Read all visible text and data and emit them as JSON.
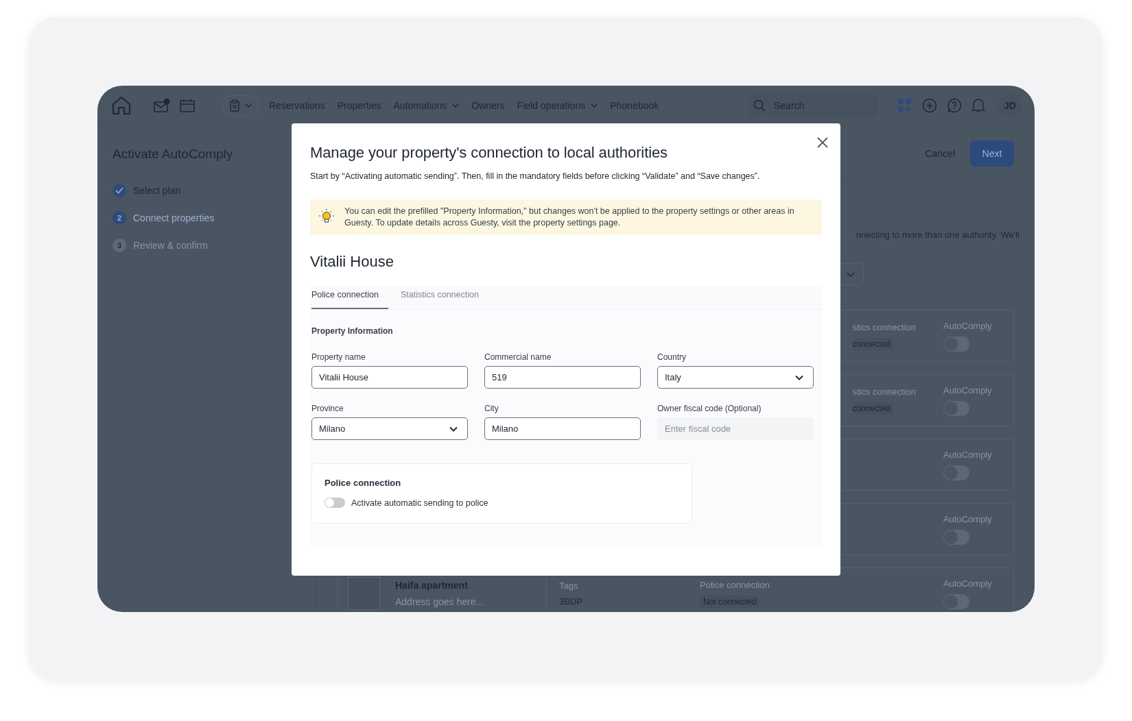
{
  "nav": {
    "items": [
      {
        "label": "Reservations",
        "dropdown": false
      },
      {
        "label": "Properties",
        "dropdown": false
      },
      {
        "label": "Automations",
        "dropdown": true
      },
      {
        "label": "Owners",
        "dropdown": false
      },
      {
        "label": "Field operations",
        "dropdown": true
      },
      {
        "label": "Phonebook",
        "dropdown": false
      }
    ],
    "search": {
      "placeholder": "Search"
    },
    "avatar": "JD"
  },
  "sidebar": {
    "title": "Activate AutoComply",
    "steps": [
      {
        "label": "Select plan",
        "completed": true,
        "selected": false
      },
      {
        "label": "Connect properties",
        "completed": false,
        "selected": true,
        "number": "2"
      },
      {
        "label": "Review & confirm",
        "completed": false,
        "selected": false,
        "number": "3"
      }
    ]
  },
  "header": {
    "cancel": "Cancel",
    "next": "Next"
  },
  "intro_text": "nnecting to more than one authority. We'll",
  "property_rows": [
    {
      "kind": "partial",
      "statistics_label": "stics connection",
      "status": "connected",
      "autocomply_label": "AutoComply",
      "on": false
    },
    {
      "kind": "partial",
      "statistics_label": "stics connection",
      "status": "connected",
      "autocomply_label": "AutoComply",
      "on": false
    },
    {
      "kind": "toggle",
      "autocomply_label": "AutoComply",
      "on": false
    },
    {
      "kind": "toggle",
      "autocomply_label": "AutoComply",
      "on": false
    },
    {
      "kind": "full",
      "name": "Haifa apartment",
      "address": "Address goes here...",
      "tags_label": "Tags",
      "tag": "3BDP",
      "police_label": "Police connection",
      "status": "Not connected",
      "autocomply_label": "AutoComply",
      "on": false
    }
  ],
  "modal": {
    "title": "Manage your property's connection to local authorities",
    "subtitle": "Start by “Activating automatic sending”. Then, fill in the mandatory fields before clicking “Validate” and “Save changes”.",
    "notice": "You can edit the prefilled \"Property Information,\" but changes won't be applied to the property settings or other areas in Guesty. To update details across Guesty, visit the property settings page.",
    "property_title": "Vitalii House",
    "tabs": [
      {
        "label": "Police connection",
        "selected": true
      },
      {
        "label": "Statistics connection",
        "selected": false
      }
    ],
    "section_title": "Property Information",
    "fields": [
      {
        "label": "Property name",
        "kind": "text",
        "value": "Vitalii House",
        "disabled": false
      },
      {
        "label": "Commercial name",
        "kind": "text",
        "value": "519",
        "disabled": false
      },
      {
        "label": "Country",
        "kind": "select",
        "value": "Italy",
        "disabled": false
      },
      {
        "label": "Province",
        "kind": "select",
        "value": "Milano",
        "disabled": false
      },
      {
        "label": "City",
        "kind": "text",
        "value": "Milano",
        "disabled": false
      },
      {
        "label": "Owner fiscal code (Optional)",
        "kind": "text",
        "placeholder": "Enter fiscal code",
        "disabled": true
      }
    ],
    "connection": {
      "title": "Police connection",
      "toggle": {
        "label": "Activate automatic sending to police",
        "on": false
      }
    }
  }
}
